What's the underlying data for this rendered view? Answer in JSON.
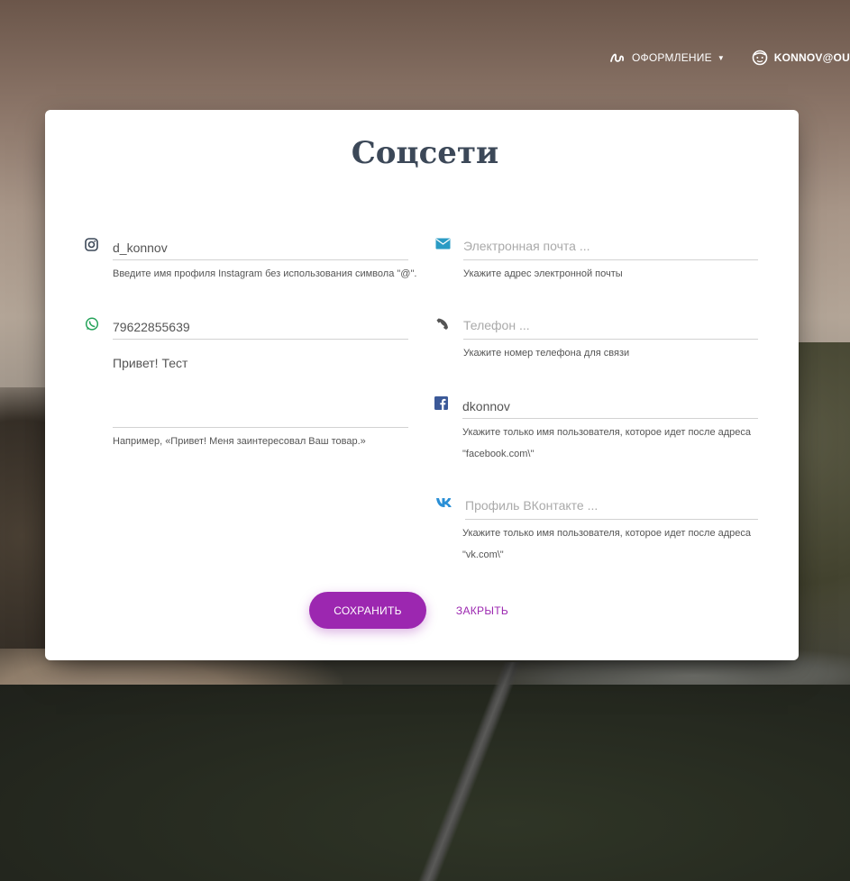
{
  "nav": {
    "design_label": "ОФОРМЛЕНИЕ",
    "user_label": "KONNOV@OUTLO"
  },
  "card": {
    "title": "Соцсети",
    "instagram": {
      "value": "d_konnov",
      "hint": "Введите имя профиля Instagram без использования символа \"@\"."
    },
    "whatsapp": {
      "value": "79622855639",
      "message": "Привет! Тест",
      "hint": "Например, «Привет! Меня заинтересовал Ваш товар.»"
    },
    "email": {
      "value": "",
      "placeholder": "Электронная почта ...",
      "hint": "Укажите адрес электронной почты"
    },
    "phone": {
      "value": "",
      "placeholder": "Телефон ...",
      "hint": "Укажите номер телефона для связи"
    },
    "facebook": {
      "value": "dkonnov",
      "hint_line1": "Укажите только имя пользователя, которое идет после адреса",
      "hint_line2": "\"facebook.com\\\""
    },
    "vk": {
      "value": "",
      "placeholder": "Профиль ВКонтакте ...",
      "hint_line1": "Укажите только имя пользователя, которое идет после адреса",
      "hint_line2": "\"vk.com\\\""
    },
    "save_label": "СОХРАНИТЬ",
    "close_label": "ЗАКРЫТЬ"
  },
  "colors": {
    "accent": "#9c27b0",
    "title": "#3c4858",
    "whatsapp": "#25a35a",
    "email": "#2a9bc4",
    "facebook": "#3b5998",
    "vk": "#2a8fd6"
  },
  "icons": {
    "design": "brush-icon",
    "user": "face-icon",
    "instagram": "instagram-icon",
    "whatsapp": "whatsapp-icon",
    "email": "envelope-icon",
    "phone": "phone-icon",
    "facebook": "facebook-icon",
    "vk": "vk-icon"
  }
}
